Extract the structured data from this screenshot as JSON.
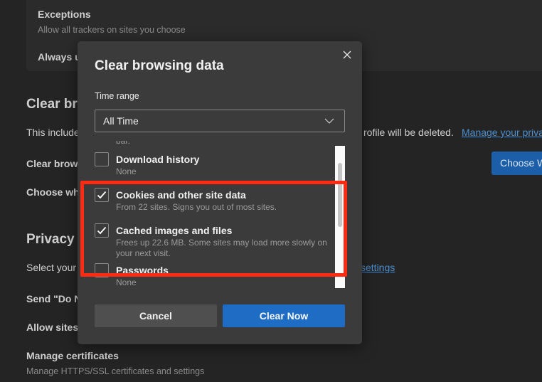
{
  "background": {
    "exceptions": {
      "title": "Exceptions",
      "subtitle": "Allow all trackers on sites you choose"
    },
    "always_label": "Always u",
    "clear_heading": "Clear br",
    "clear_desc_left": "This include",
    "clear_desc_right": "rofile will be deleted.",
    "manage_privacy_link": "Manage your priva",
    "clear_browsing_label": "Clear brow",
    "choose_what_label": "Choose wh",
    "choose_button": "Choose W",
    "privacy_heading": "Privacy",
    "select_your_label": "Select your",
    "settings_link": "settings",
    "send_dnt_label": "Send \"Do N",
    "allow_sites_label": "Allow sites",
    "manage_certs": {
      "title": "Manage certificates",
      "subtitle": "Manage HTTPS/SSL certificates and settings"
    }
  },
  "dialog": {
    "title": "Clear browsing data",
    "close_icon": "close-icon",
    "time_range_label": "Time range",
    "time_range_value": "All Time",
    "partial_text": "bar.",
    "items": [
      {
        "title": "Download history",
        "desc": "None",
        "checked": false
      },
      {
        "title": "Cookies and other site data",
        "desc": "From 22 sites. Signs you out of most sites.",
        "checked": true
      },
      {
        "title": "Cached images and files",
        "desc": "Frees up 22.6 MB. Some sites may load more slowly on your next visit.",
        "checked": true
      },
      {
        "title": "Passwords",
        "desc": "None",
        "checked": false
      }
    ],
    "cancel_label": "Cancel",
    "clear_label": "Clear Now"
  },
  "colors": {
    "accent": "#1f6cc4",
    "highlight": "#ff2a12",
    "link": "#4a8fd1"
  }
}
